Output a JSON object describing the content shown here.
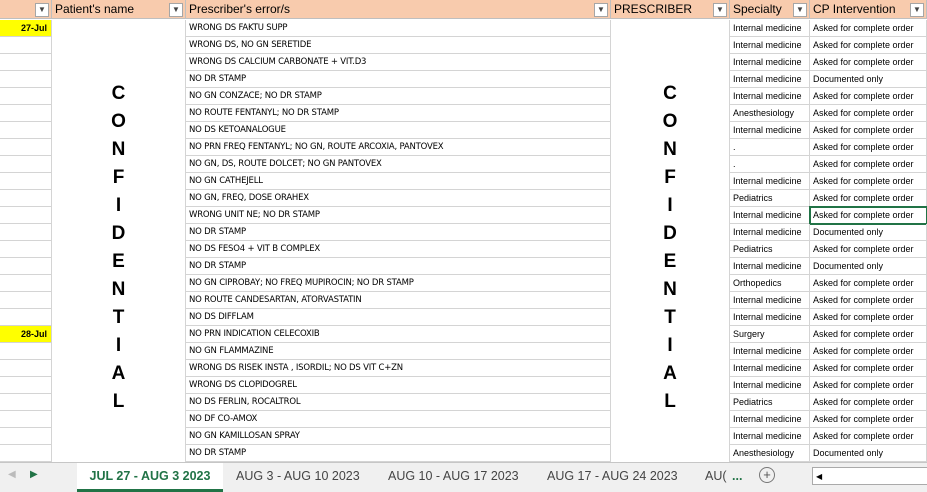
{
  "headers": {
    "b": "Patient's name",
    "c": "Prescriber's error/s",
    "d": "PRESCRIBER",
    "e": "Specialty",
    "f": "CP Intervention"
  },
  "confidential": [
    "C",
    "O",
    "N",
    "F",
    "I",
    "D",
    "E",
    "N",
    "T",
    "I",
    "A",
    "L"
  ],
  "rows": [
    {
      "date": "27-Jul",
      "error": "WRONG DS FAKTU SUPP",
      "specialty": "Internal medicine",
      "cp": "Asked for complete order"
    },
    {
      "date": "",
      "error": "WRONG DS, NO GN SERETIDE",
      "specialty": "Internal medicine",
      "cp": "Asked for complete order"
    },
    {
      "date": "",
      "error": "WRONG DS CALCIUM CARBONATE + VIT.D3",
      "specialty": "Internal medicine",
      "cp": "Asked for complete order"
    },
    {
      "date": "",
      "error": "NO DR STAMP",
      "specialty": "Internal medicine",
      "cp": "Documented only"
    },
    {
      "date": "",
      "error": "NO GN CONZACE; NO DR STAMP",
      "specialty": "Internal medicine",
      "cp": "Asked for complete order"
    },
    {
      "date": "",
      "error": "NO ROUTE FENTANYL; NO DR STAMP",
      "specialty": "Anesthesiology",
      "cp": "Asked for complete order"
    },
    {
      "date": "",
      "error": "NO DS KETOANALOGUE",
      "specialty": "Internal medicine",
      "cp": "Asked for complete order"
    },
    {
      "date": "",
      "error": "NO PRN FREQ FENTANYL; NO GN, ROUTE ARCOXIA, PANTOVEX",
      "specialty": ".",
      "cp": "Asked for complete order"
    },
    {
      "date": "",
      "error": "NO GN, DS, ROUTE DOLCET; NO GN PANTOVEX",
      "specialty": ".",
      "cp": "Asked for complete order"
    },
    {
      "date": "",
      "error": "NO GN CATHEJELL",
      "specialty": "Internal medicine",
      "cp": "Asked for complete order"
    },
    {
      "date": "",
      "error": "NO GN, FREQ, DOSE ORAHEX",
      "specialty": "Pediatrics",
      "cp": "Asked for complete order"
    },
    {
      "date": "",
      "error": "WRONG UNIT NE; NO DR STAMP",
      "specialty": "Internal medicine",
      "cp": "Asked for complete order"
    },
    {
      "date": "",
      "error": "NO DR STAMP",
      "specialty": "Internal medicine",
      "cp": "Documented only"
    },
    {
      "date": "",
      "error": "NO DS FESO4 + VIT B COMPLEX",
      "specialty": "Pediatrics",
      "cp": "Asked for complete order"
    },
    {
      "date": "",
      "error": "NO DR STAMP",
      "specialty": "Internal medicine",
      "cp": "Documented only"
    },
    {
      "date": "",
      "error": "NO GN CIPROBAY; NO FREQ MUPIROCIN; NO DR STAMP",
      "specialty": "Orthopedics",
      "cp": "Asked for complete order"
    },
    {
      "date": "",
      "error": "NO ROUTE CANDESARTAN, ATORVASTATIN",
      "specialty": "Internal medicine",
      "cp": "Asked for complete order"
    },
    {
      "date": "",
      "error": "NO DS DIFFLAM",
      "specialty": "Internal medicine",
      "cp": "Asked for complete order"
    },
    {
      "date": "28-Jul",
      "error": "NO PRN INDICATION CELECOXIB",
      "specialty": "Surgery",
      "cp": "Asked for complete order"
    },
    {
      "date": "",
      "error": "NO GN FLAMMAZINE",
      "specialty": "Internal medicine",
      "cp": "Asked for complete order"
    },
    {
      "date": "",
      "error": "WRONG DS RISEK INSTA , ISORDIL; NO DS VIT C+ZN",
      "specialty": "Internal medicine",
      "cp": "Asked for complete order"
    },
    {
      "date": "",
      "error": "WRONG DS CLOPIDOGREL",
      "specialty": "Internal medicine",
      "cp": "Asked for complete order"
    },
    {
      "date": "",
      "error": "NO DS FERLIN, ROCALTROL",
      "specialty": "Pediatrics",
      "cp": "Asked for complete order"
    },
    {
      "date": "",
      "error": "NO DF CO-AMOX",
      "specialty": "Internal medicine",
      "cp": "Asked for complete order"
    },
    {
      "date": "",
      "error": "NO GN KAMILLOSAN SPRAY",
      "specialty": "Internal medicine",
      "cp": "Asked for complete order"
    },
    {
      "date": "",
      "error": "NO DR STAMP",
      "specialty": "Anesthesiology",
      "cp": "Documented only"
    }
  ],
  "tabs": [
    "JUL 27 - AUG 3 2023",
    "AUG 3 - AUG 10 2023",
    "AUG 10 - AUG 17 2023",
    "AUG 17 - AUG 24 2023",
    "AU("
  ],
  "more_label": "...",
  "add_label": "+"
}
